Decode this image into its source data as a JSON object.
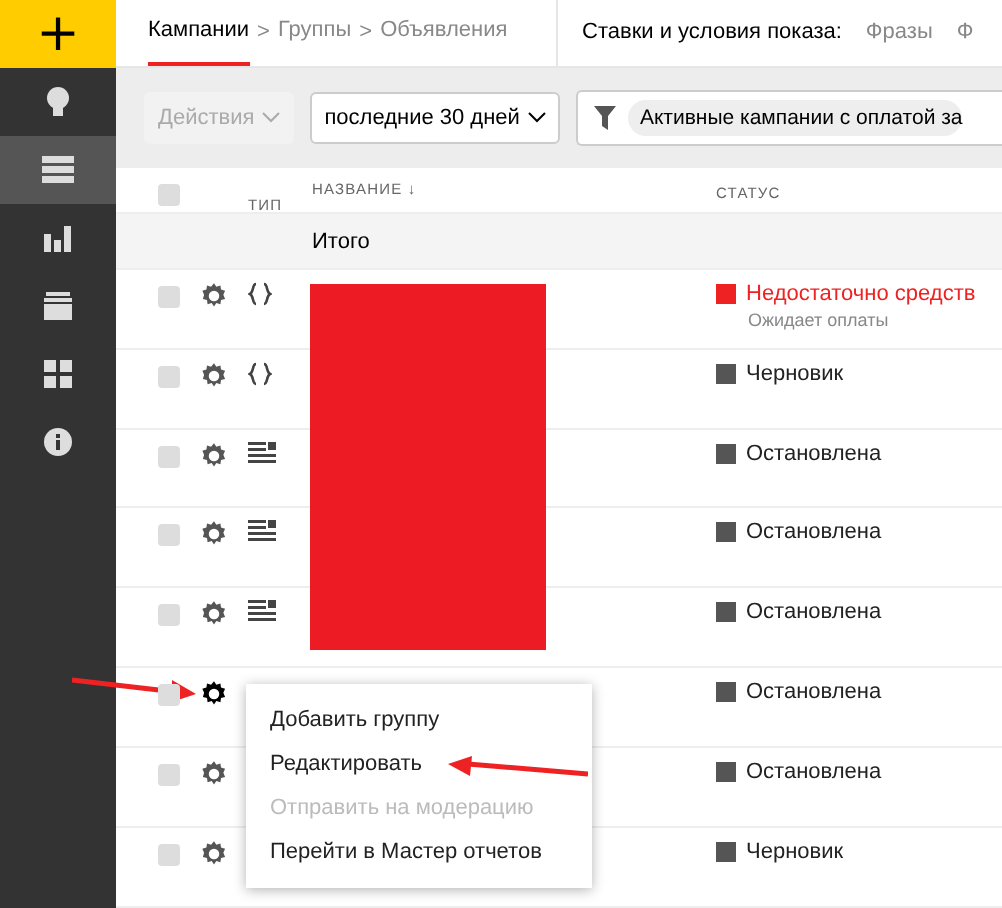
{
  "sidebar": {
    "add_label": "+",
    "items": [
      {
        "selected": false
      },
      {
        "selected": true
      },
      {
        "selected": false
      },
      {
        "selected": false
      },
      {
        "selected": false
      },
      {
        "selected": false
      }
    ]
  },
  "breadcrumbs": [
    {
      "label": "Кампании",
      "selected": true
    },
    {
      "label": "Группы",
      "selected": false
    },
    {
      "label": "Объявления",
      "selected": false
    }
  ],
  "breadcrumb_separator": ">",
  "bids": {
    "label": "Ставки и условия показа:",
    "tabs": [
      "Фразы",
      "Ф"
    ]
  },
  "toolbar": {
    "actions": {
      "label": "Действия",
      "disabled": true
    },
    "period": "последние 30 дней",
    "filter": "Активные кампании с оплатой за"
  },
  "table": {
    "columns": [
      "ТИП",
      "НАЗВАНИЕ ↓",
      "СТАТУС"
    ],
    "select_all_checked": false,
    "total_label": "Итого",
    "rows": [
      {
        "checked": false,
        "kind": "code",
        "active": false,
        "status": "Недостаточно средств",
        "status_error": true,
        "note": "Ожидает оплаты"
      },
      {
        "checked": false,
        "kind": "code",
        "active": false,
        "status": "Черновик",
        "status_error": false
      },
      {
        "checked": false,
        "kind": "text",
        "active": false,
        "status": "Остановлена",
        "status_error": false
      },
      {
        "checked": false,
        "kind": "text",
        "active": false,
        "status": "Остановлена",
        "status_error": false
      },
      {
        "checked": false,
        "kind": "text",
        "active": false,
        "status": "Остановлена",
        "status_error": false
      },
      {
        "checked": false,
        "kind": "none",
        "active": true,
        "status": "Остановлена",
        "status_error": false
      },
      {
        "checked": false,
        "kind": "none",
        "active": false,
        "status": "Остановлена",
        "status_error": false
      },
      {
        "checked": false,
        "kind": "none",
        "active": false,
        "status": "Черновик",
        "status_error": false
      }
    ]
  },
  "context_menu": [
    {
      "label": "Добавить группу",
      "disabled": false
    },
    {
      "label": "Редактировать",
      "disabled": false
    },
    {
      "label": "Отправить на модерацию",
      "disabled": true
    },
    {
      "label": "Перейти в Мастер отчетов",
      "disabled": false
    }
  ]
}
